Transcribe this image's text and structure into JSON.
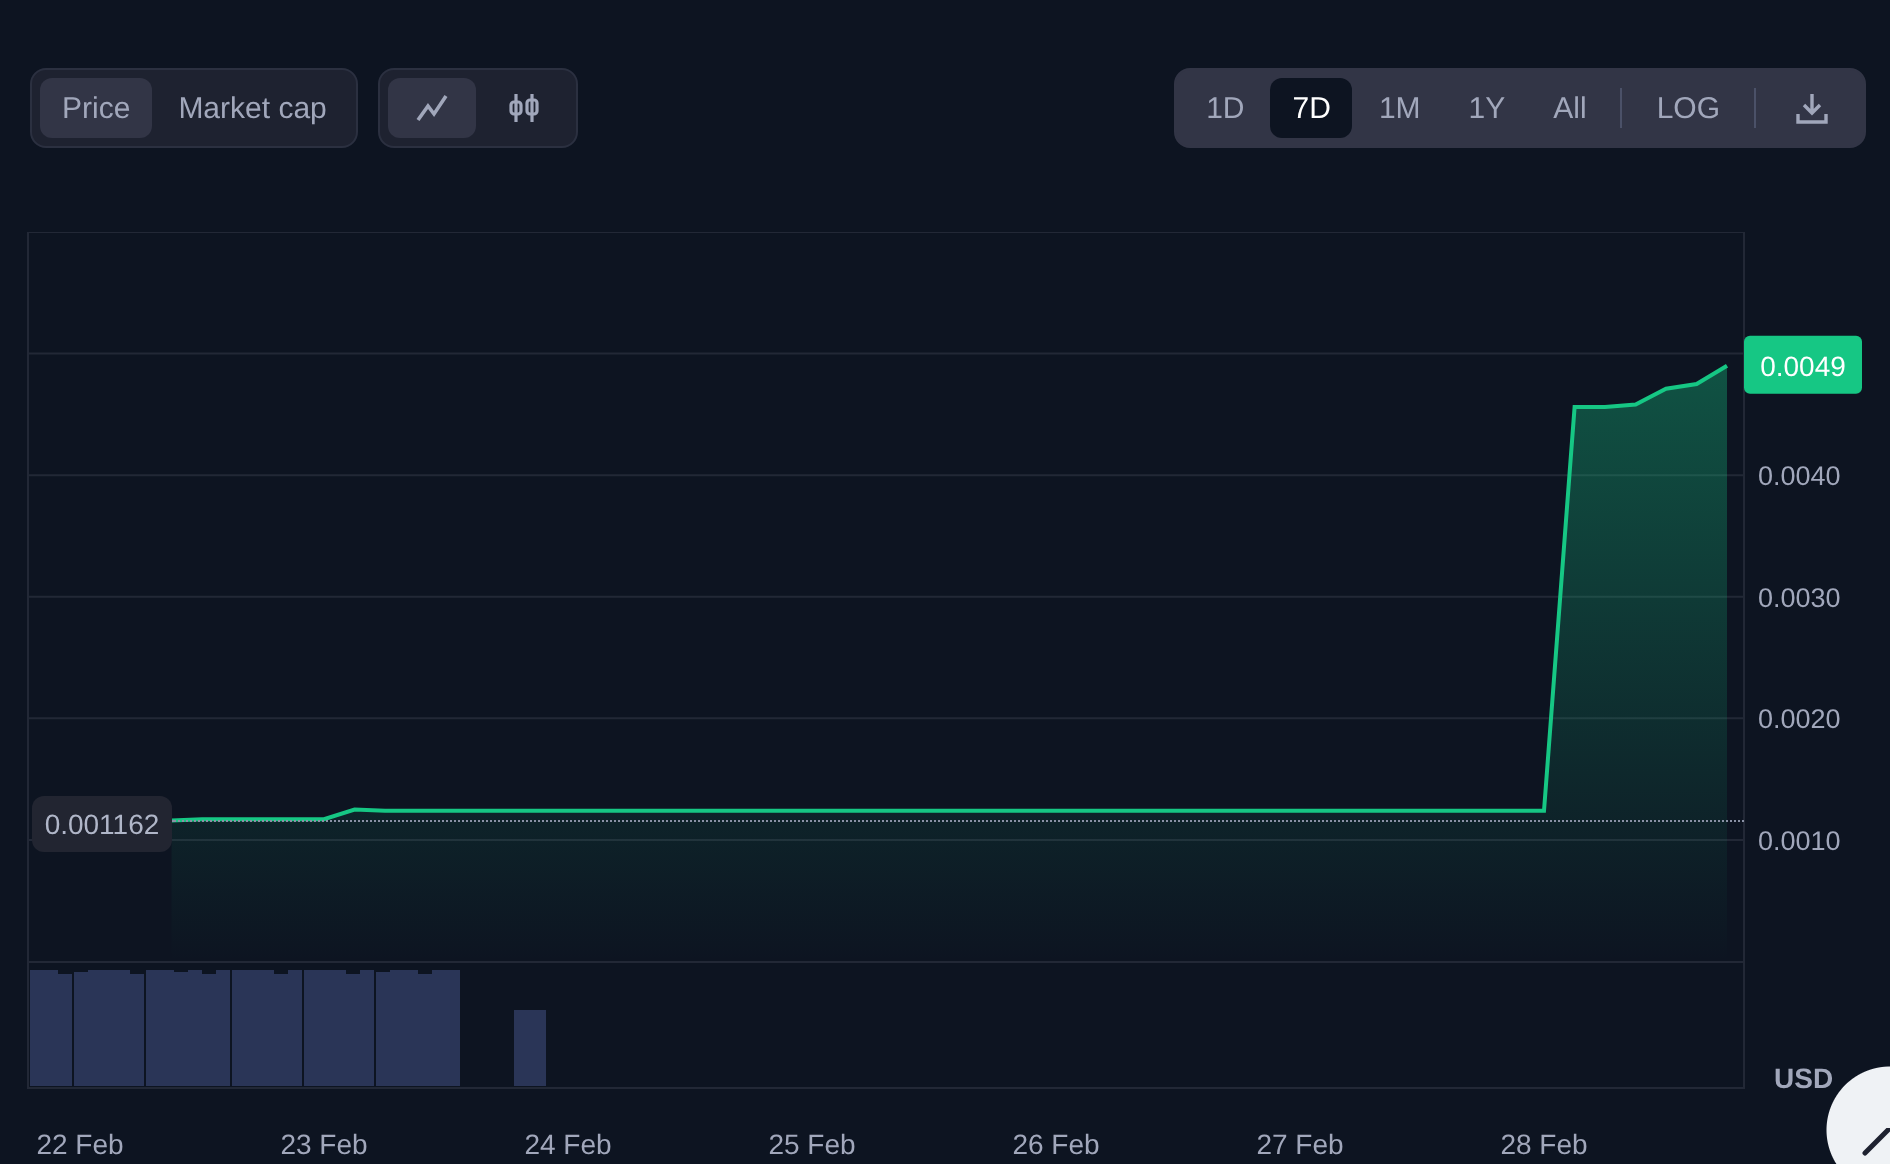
{
  "price_toggle": [
    {
      "label": "Price",
      "selected": true
    },
    {
      "label": "Market cap",
      "selected": false
    }
  ],
  "chart_type": [
    {
      "kind": "line",
      "selected": true
    },
    {
      "kind": "candles",
      "selected": false
    }
  ],
  "ranges": [
    {
      "label": "1D",
      "selected": false
    },
    {
      "label": "7D",
      "selected": true
    },
    {
      "label": "1M",
      "selected": false
    },
    {
      "label": "1Y",
      "selected": false
    },
    {
      "label": "All",
      "selected": false
    }
  ],
  "log": {
    "label": "LOG"
  },
  "chart": {
    "current_price": "0.0049",
    "start_price": "0.001162",
    "currency": "USD",
    "chart_data": {
      "type": "area",
      "grid": true,
      "categories": [
        null,
        "22 Feb",
        null,
        null,
        null,
        null,
        null,
        null,
        null,
        "23 Feb",
        null,
        null,
        null,
        null,
        null,
        null,
        null,
        "24 Feb",
        null,
        null,
        null,
        null,
        null,
        null,
        null,
        "25 Feb",
        null,
        null,
        null,
        null,
        null,
        null,
        null,
        "26 Feb",
        null,
        null,
        null,
        null,
        null,
        null,
        null,
        "27 Feb",
        null,
        null,
        null,
        null,
        null,
        null,
        null,
        "28 Feb",
        null,
        null,
        null,
        null,
        null,
        null
      ],
      "series": [
        {
          "color": "#16c784",
          "values": [
            null,
            null,
            null,
            null,
            0.00116,
            0.00117,
            0.00117,
            0.00117,
            0.00117,
            0.00117,
            0.00125,
            0.00124,
            0.00124,
            0.00124,
            0.00124,
            0.00124,
            0.00124,
            0.00124,
            0.00124,
            0.00124,
            0.00124,
            0.00124,
            0.00124,
            0.00124,
            0.00124,
            0.00124,
            0.00124,
            0.00124,
            0.00124,
            0.00124,
            0.00124,
            0.00124,
            0.00124,
            0.00124,
            0.00124,
            0.00124,
            0.00124,
            0.00124,
            0.00124,
            0.00124,
            0.00124,
            0.00124,
            0.00124,
            0.00124,
            0.00124,
            0.00124,
            0.00124,
            0.00124,
            0.00124,
            0.00124,
            0.00456,
            0.00456,
            0.00458,
            0.00471,
            0.00475,
            0.0049
          ]
        }
      ],
      "ylim": [
        -0.00104,
        0.006
      ],
      "yticks": [
        {
          "value": 0.001,
          "label": "0.0010"
        },
        {
          "value": 0.002,
          "label": "0.0020"
        },
        {
          "value": 0.003,
          "label": "0.0030"
        },
        {
          "value": 0.004,
          "label": "0.0040"
        }
      ]
    }
  }
}
